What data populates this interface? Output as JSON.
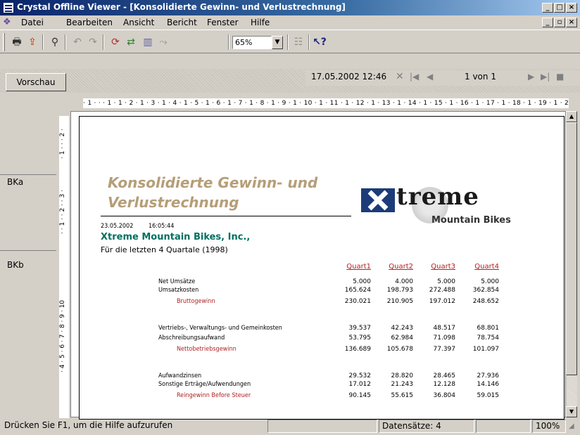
{
  "window": {
    "title": "Crystal Offline Viewer - [Konsolidierte Gewinn- und Verlustrechnung]"
  },
  "menu": {
    "items": [
      "Datei",
      "Bearbeiten",
      "Ansicht",
      "Bericht",
      "Fenster",
      "Hilfe"
    ]
  },
  "toolbar": {
    "zoom": "65%"
  },
  "tabs": {
    "preview": "Vorschau"
  },
  "nav": {
    "datetime": "17.05.2002 12:46",
    "page": "1 von 1"
  },
  "ruler": {
    "h": "· 1 · · · 1 · 1 · 2 · 1 · 3 · 1 · 4 · 1 · 5 · 1 · 6 · 1 · 7 · 1 · 8 · 1 · 9 · 1 · 10 · 1 · 11 · 1 · 12 · 1 · 13 · 1 · 14 · 1 · 15 · 1 · 16 · 1 · 17 · 1 · 18 · 1 · 19 · 1 · 20",
    "v_top": "· 1 · · · 2 ·",
    "v_bka": "· · 1 · · 2 · · 3 ·",
    "v_bkb": "· 4 · 5 · 6 · 7 · 8 · 9 · 10"
  },
  "sections": {
    "a": "BKa",
    "b": "BKb"
  },
  "report": {
    "title_line1": "Konsolidierte Gewinn- und",
    "title_line2": "Verlustrechnung",
    "date": "23.05.2002",
    "time": "16:05:44",
    "company": "Xtreme Mountain Bikes, Inc.,",
    "period": "Für die letzten 4 Quartale (1998)",
    "logo_word": "treme",
    "logo_sub": "Mountain Bikes",
    "headers": [
      "Quart1",
      "Quart2",
      "Quart3",
      "Quart4"
    ],
    "rows": [
      {
        "label": "Net Umsätze",
        "values": [
          "5.000",
          "4.000",
          "5.000",
          "5.000"
        ],
        "highlight": false
      },
      {
        "label": "Umsatzkosten",
        "values": [
          "165.624",
          "198.793",
          "272.488",
          "362.854"
        ],
        "highlight": false
      },
      {
        "label": "Bruttogewinn",
        "values": [
          "230.021",
          "210.905",
          "197.012",
          "248.652"
        ],
        "highlight": true
      },
      {
        "label": "Vertriebs-, Verwaltungs- und Gemeinkosten",
        "values": [
          "39.537",
          "42.243",
          "48.517",
          "68.801"
        ],
        "highlight": false
      },
      {
        "label": "Abschreibungsaufwand",
        "values": [
          "53.795",
          "62.984",
          "71.098",
          "78.754"
        ],
        "highlight": false
      },
      {
        "label": "Nettobetriebsgewinn",
        "values": [
          "136.689",
          "105.678",
          "77.397",
          "101.097"
        ],
        "highlight": true
      },
      {
        "label": "Aufwandzinsen",
        "values": [
          "29.532",
          "28.820",
          "28.465",
          "27.936"
        ],
        "highlight": false
      },
      {
        "label": "Sonstige Erträge/Aufwendungen",
        "values": [
          "17.012",
          "21.243",
          "12.128",
          "14.146"
        ],
        "highlight": false
      },
      {
        "label": "Reingewinn Before Steuer",
        "values": [
          "90.145",
          "55.615",
          "36.804",
          "59.015"
        ],
        "highlight": true
      }
    ]
  },
  "status": {
    "help": "Drücken Sie F1, um die Hilfe aufzurufen",
    "records": "Datensätze: 4",
    "zoom": "100%"
  }
}
